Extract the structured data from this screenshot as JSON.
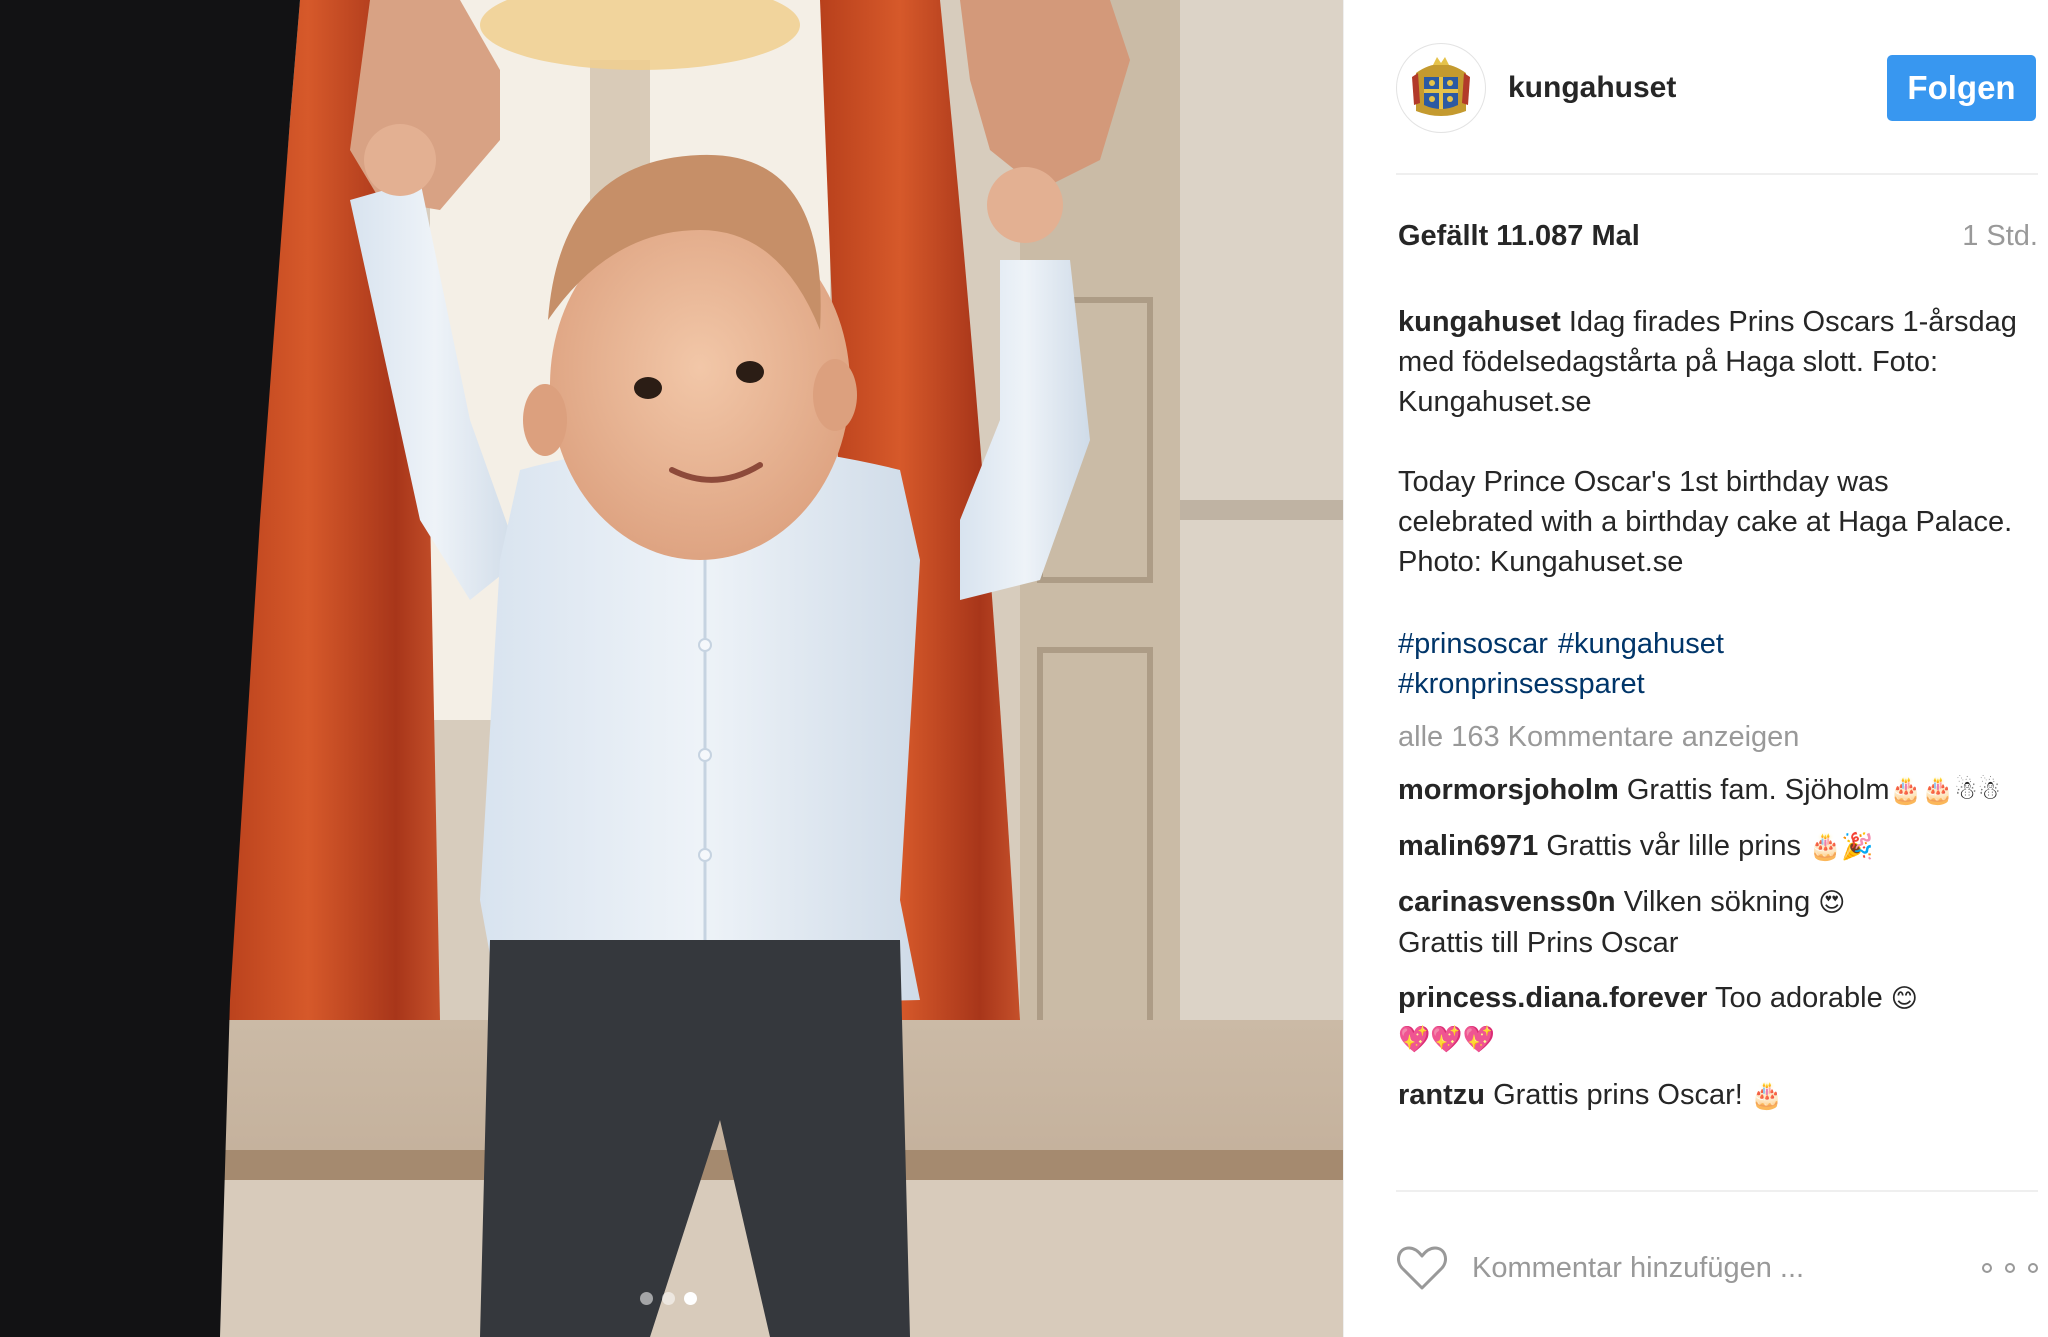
{
  "post": {
    "username": "kungahuset",
    "follow_label": "Folgen",
    "likes": "Gefällt 11.087 Mal",
    "time": "1 Std.",
    "caption_sv": "Idag firades Prins Oscars 1-årsdag med födelsedagstårta på Haga slott. Foto: Kungahuset.se",
    "caption_en": "Today Prince Oscar's 1st birthday was celebrated with a birthday cake at Haga Palace. Photo: Kungahuset.se",
    "hashtags": [
      "#prinsoscar",
      "#kungahuset",
      "#kronprinsessparet"
    ],
    "view_all": "alle 163 Kommentare anzeigen",
    "comment_placeholder": "Kommentar hinzufügen ...",
    "link_color": "#003569",
    "follow_color": "#3897f0"
  },
  "carousel": {
    "count": 3,
    "active_index": 3
  },
  "comments": [
    {
      "user": "mormorsjoholm",
      "text": "Grattis fam. Sjöholm",
      "emoji": "🎂🎂☃☃"
    },
    {
      "user": "malin6971",
      "text": "Grattis vår lille prins",
      "emoji": "🎂🎉"
    },
    {
      "user": "carinasvenss0n",
      "text": "Vilken sökning",
      "emoji": "😍",
      "text2": "Grattis till Prins Oscar"
    },
    {
      "user": "princess.diana.forever",
      "text": "Too adorable",
      "emoji": "😊",
      "emoji2": "💖💖💖"
    },
    {
      "user": "rantzu",
      "text": "Grattis prins Oscar!",
      "emoji": "🎂"
    }
  ],
  "icons": {
    "avatar": "royal-coat-of-arms",
    "like": "heart-outline-icon",
    "more": "more-options-icon"
  }
}
